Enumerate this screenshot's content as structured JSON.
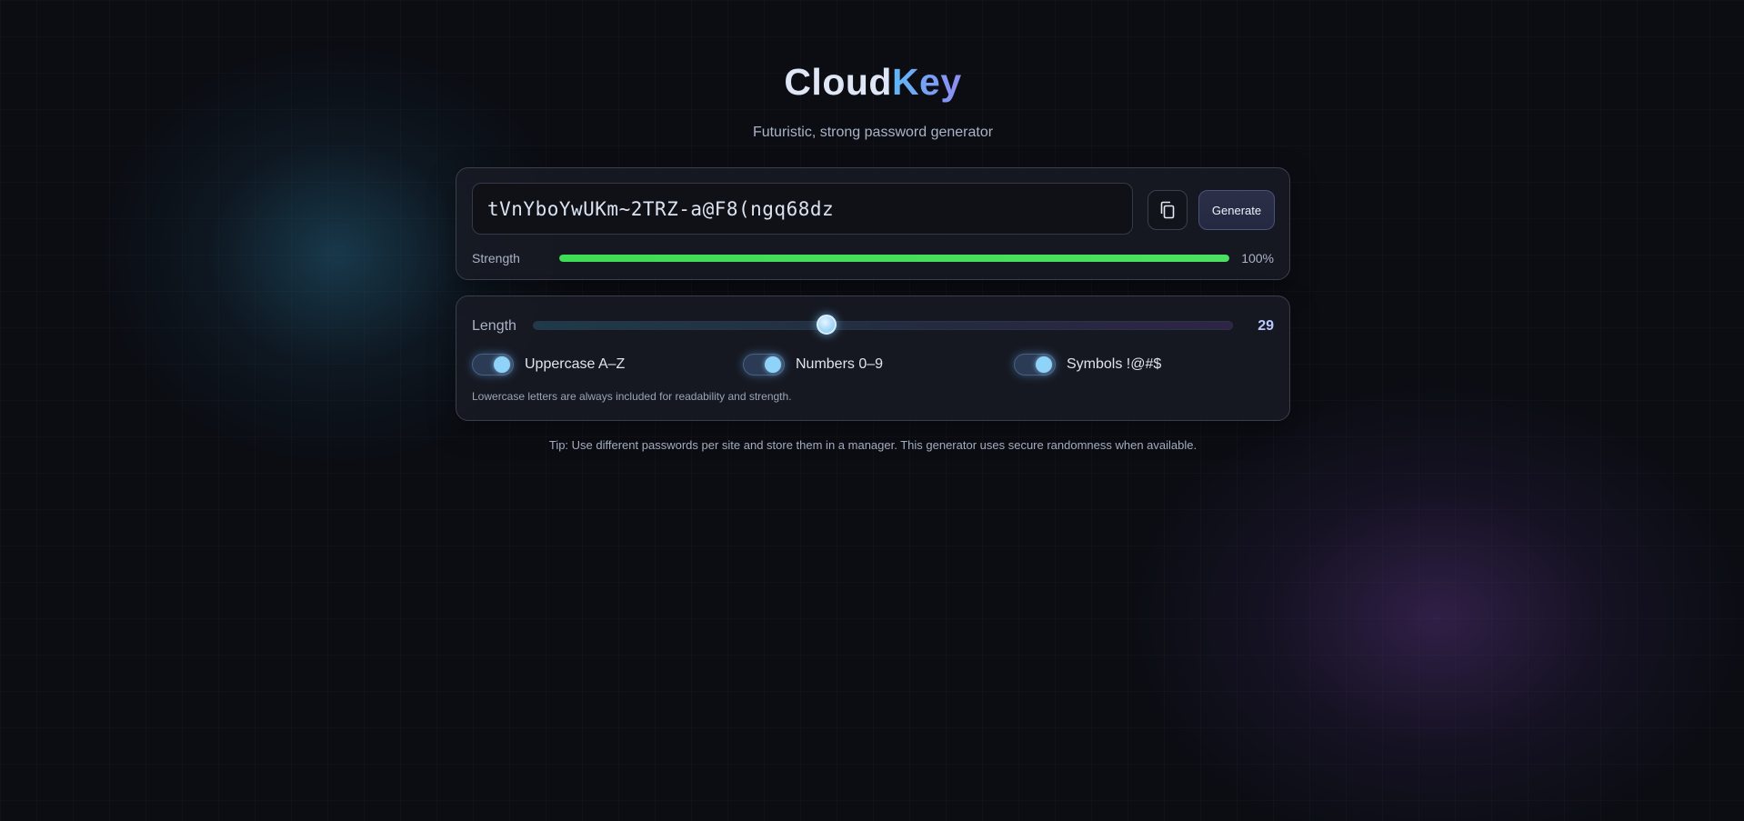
{
  "header": {
    "title_part1": "Cloud",
    "title_part2": "Key",
    "subtitle": "Futuristic, strong password generator"
  },
  "output": {
    "password": "tVnYboYwUKm~2TRZ-a@F8(ngq68dz",
    "copy_icon": "copy-icon",
    "generate_label": "Generate"
  },
  "strength": {
    "label": "Strength",
    "value_text": "100%",
    "fraction": 1.0,
    "color": "#4be061"
  },
  "options": {
    "length_label": "Length",
    "length_value": "29",
    "length_fraction": 0.42,
    "toggles": [
      {
        "label": "Uppercase A–Z",
        "on": true
      },
      {
        "label": "Numbers 0–9",
        "on": true
      },
      {
        "label": "Symbols !@#$",
        "on": true
      }
    ],
    "note": "Lowercase letters are always included for readability and strength."
  },
  "tip": "Tip: Use different passwords per site and store them in a manager. This generator uses secure randomness when available.",
  "colors": {
    "accent_blue": "#5fb6f6",
    "accent_violet": "#8f8cf2",
    "background": "#0b0d13"
  }
}
